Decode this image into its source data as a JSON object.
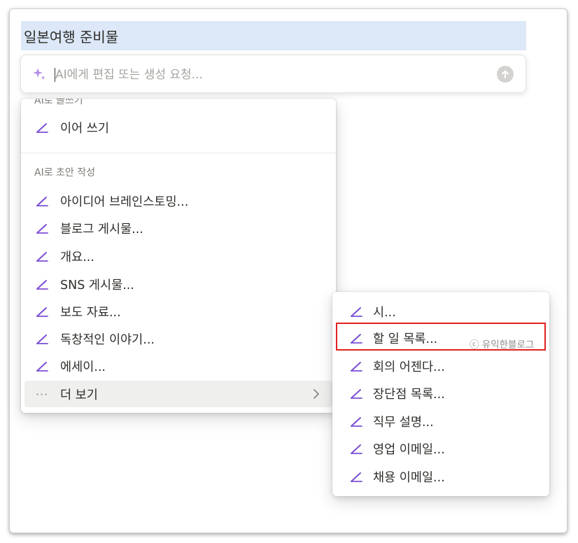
{
  "page": {
    "title": "일본여행 준비물"
  },
  "ai_prompt": {
    "placeholder": "AI에게 편집 또는 생성 요청...",
    "sparkle_icon": "sparkle-icon",
    "send_icon": "arrow-up-icon"
  },
  "left_menu": {
    "section_write": "AI로 글쓰기",
    "continue_label": "이어 쓰기",
    "section_draft": "AI로 초안 작성",
    "items": [
      {
        "label": "아이디어 브레인스토밍..."
      },
      {
        "label": "블로그 게시물..."
      },
      {
        "label": "개요..."
      },
      {
        "label": "SNS 게시물..."
      },
      {
        "label": "보도 자료..."
      },
      {
        "label": "독창적인 이야기..."
      },
      {
        "label": "에세이..."
      }
    ],
    "more_label": "더 보기",
    "item_icon": "pencil-icon",
    "more_icon": "ellipsis-icon",
    "chevron_icon": "chevron-right-icon"
  },
  "right_menu": {
    "items": [
      {
        "label": "시..."
      },
      {
        "label": "할 일 목록..."
      },
      {
        "label": "회의 어젠다..."
      },
      {
        "label": "장단점 목록..."
      },
      {
        "label": "직무 설명..."
      },
      {
        "label": "영업 이메일..."
      },
      {
        "label": "채용 이메일..."
      }
    ]
  },
  "watermark": "ⓒ 유익한블로그",
  "colors": {
    "accent_purple": "#7b4fd4",
    "highlight_red": "#e02020",
    "title_bg": "#dce8f7"
  }
}
